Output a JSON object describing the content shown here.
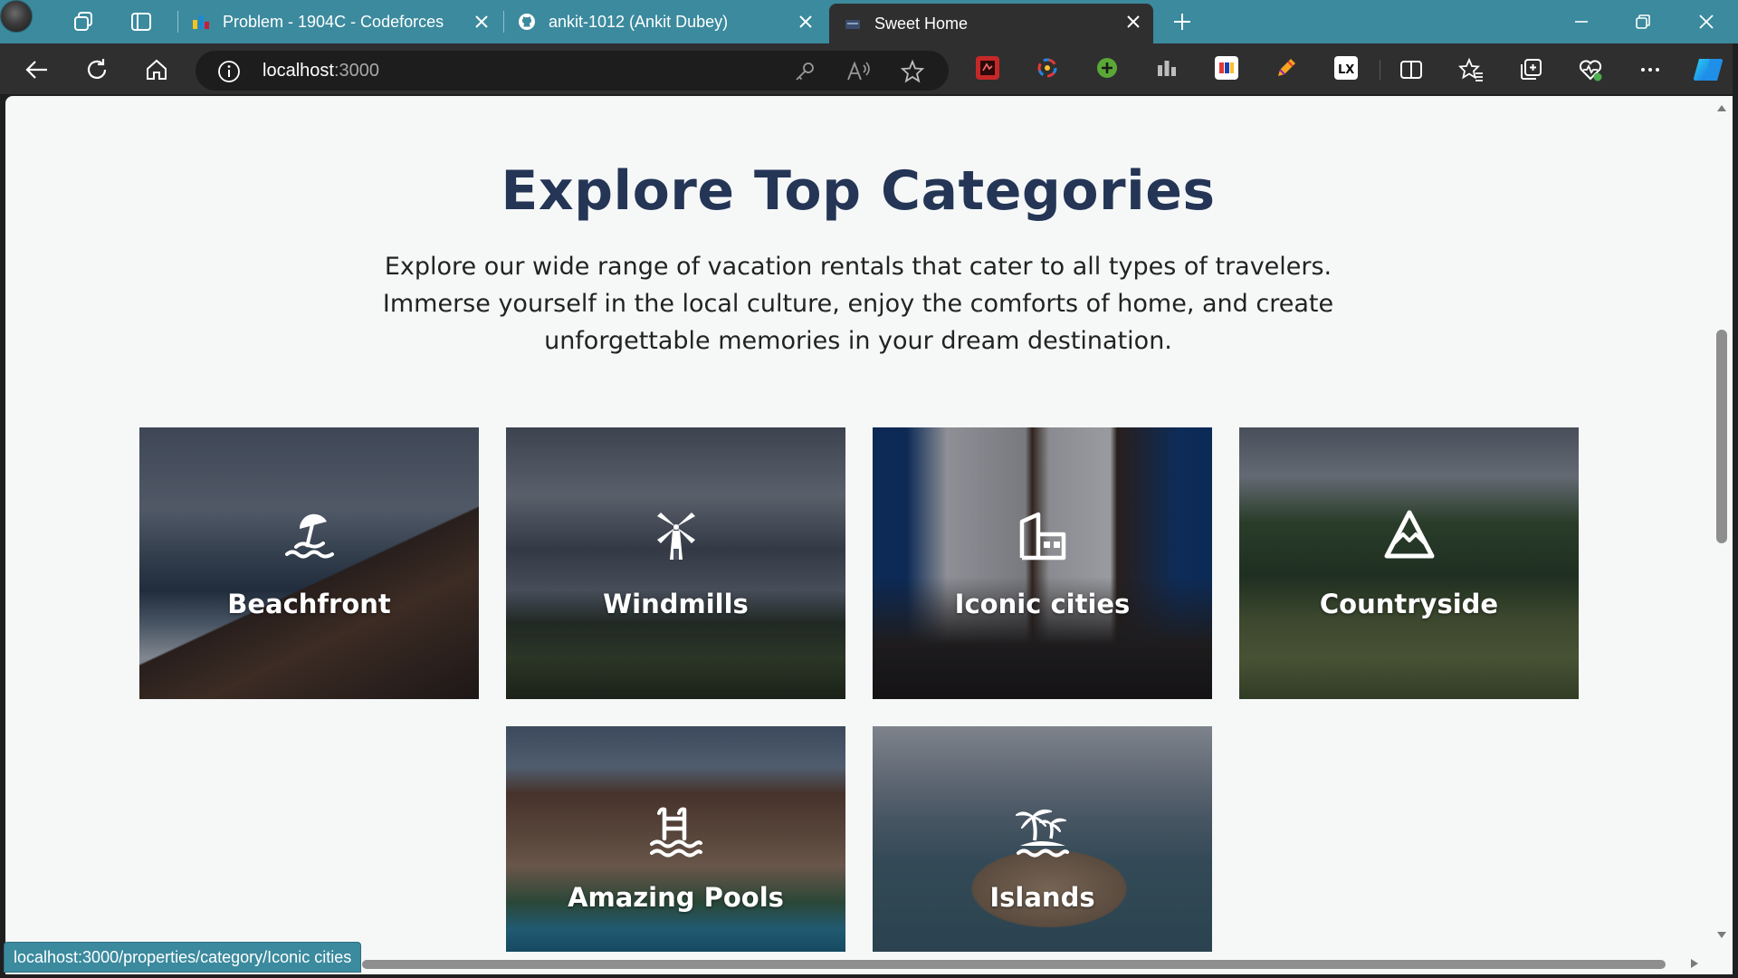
{
  "browser": {
    "tabs": [
      {
        "title": "Problem - 1904C - Codeforces",
        "active": false
      },
      {
        "title": "ankit-1012 (Ankit Dubey)",
        "active": false
      },
      {
        "title": "Sweet Home",
        "active": true
      }
    ],
    "address": {
      "host": "localhost",
      "port": ":3000"
    },
    "status_url": "localhost:3000/properties/category/Iconic cities",
    "icons": [
      "profile-avatar",
      "workspaces-icon",
      "tab-actions-icon",
      "back-icon",
      "refresh-icon",
      "home-icon",
      "info-icon",
      "key-icon",
      "read-aloud-icon",
      "favorite-star-icon",
      "split-screen-icon",
      "favorites-icon",
      "collections-icon",
      "browser-essentials-icon",
      "more-icon",
      "copilot-icon"
    ]
  },
  "page": {
    "title": "Explore Top Categories",
    "description": "Explore our wide range of vacation rentals that cater to all types of travelers. Immerse yourself in the local culture, enjoy the comforts of home, and create unforgettable memories in your dream destination.",
    "categories": [
      {
        "name": "Beachfront",
        "icon": "beach-umbrella-icon"
      },
      {
        "name": "Windmills",
        "icon": "windmill-icon"
      },
      {
        "name": "Iconic cities",
        "icon": "city-building-icon"
      },
      {
        "name": "Countryside",
        "icon": "mountain-icon"
      },
      {
        "name": "Amazing Pools",
        "icon": "pool-ladder-icon"
      },
      {
        "name": "Islands",
        "icon": "palm-island-icon"
      }
    ]
  },
  "colors": {
    "tab_strip": "#3b8a9e",
    "toolbar": "#2f2f2f",
    "page_background": "#f6f8f8",
    "heading": "#243556"
  }
}
